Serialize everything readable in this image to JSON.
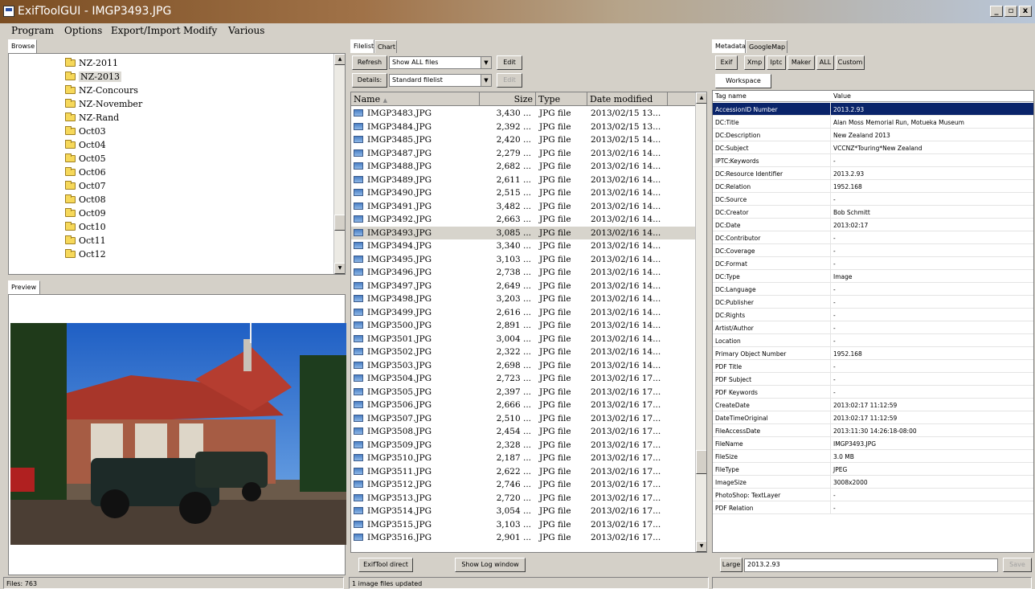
{
  "window": {
    "title": "ExifToolGUI - IMGP3493.JPG",
    "minimize": "_",
    "restore": "▫",
    "close": "x"
  },
  "menu": [
    "Program",
    "Options",
    "Export/Import",
    "Modify",
    "Various"
  ],
  "browse": {
    "tab": "Browse",
    "folders": [
      "NZ-2011",
      "NZ-2013",
      "NZ-Concours",
      "NZ-November",
      "NZ-Rand",
      "Oct03",
      "Oct04",
      "Oct05",
      "Oct06",
      "Oct07",
      "Oct08",
      "Oct09",
      "Oct10",
      "Oct11",
      "Oct12"
    ],
    "selected_index": 1
  },
  "preview": {
    "tab": "Preview"
  },
  "filelist": {
    "tabs": [
      "Filelist",
      "Chart"
    ],
    "refresh_label": "Refresh",
    "filter_value": "Show ALL files",
    "edit_label": "Edit",
    "details_label": "Details:",
    "details_value": "Standard filelist",
    "edit2_label": "Edit",
    "columns": [
      "Name",
      "Size",
      "Type",
      "Date modified"
    ],
    "rows": [
      [
        "IMGP3483.JPG",
        "3,430 ...",
        "JPG file",
        "2013/02/15 13..."
      ],
      [
        "IMGP3484.JPG",
        "2,392 ...",
        "JPG file",
        "2013/02/15 13..."
      ],
      [
        "IMGP3485.JPG",
        "2,420 ...",
        "JPG file",
        "2013/02/15 14..."
      ],
      [
        "IMGP3487.JPG",
        "2,279 ...",
        "JPG file",
        "2013/02/16 14..."
      ],
      [
        "IMGP3488.JPG",
        "2,682 ...",
        "JPG file",
        "2013/02/16 14..."
      ],
      [
        "IMGP3489.JPG",
        "2,611 ...",
        "JPG file",
        "2013/02/16 14..."
      ],
      [
        "IMGP3490.JPG",
        "2,515 ...",
        "JPG file",
        "2013/02/16 14..."
      ],
      [
        "IMGP3491.JPG",
        "3,482 ...",
        "JPG file",
        "2013/02/16 14..."
      ],
      [
        "IMGP3492.JPG",
        "2,663 ...",
        "JPG file",
        "2013/02/16 14..."
      ],
      [
        "IMGP3493.JPG",
        "3,085 ...",
        "JPG file",
        "2013/02/16 14..."
      ],
      [
        "IMGP3494.JPG",
        "3,340 ...",
        "JPG file",
        "2013/02/16 14..."
      ],
      [
        "IMGP3495.JPG",
        "3,103 ...",
        "JPG file",
        "2013/02/16 14..."
      ],
      [
        "IMGP3496.JPG",
        "2,738 ...",
        "JPG file",
        "2013/02/16 14..."
      ],
      [
        "IMGP3497.JPG",
        "2,649 ...",
        "JPG file",
        "2013/02/16 14..."
      ],
      [
        "IMGP3498.JPG",
        "3,203 ...",
        "JPG file",
        "2013/02/16 14..."
      ],
      [
        "IMGP3499.JPG",
        "2,616 ...",
        "JPG file",
        "2013/02/16 14..."
      ],
      [
        "IMGP3500.JPG",
        "2,891 ...",
        "JPG file",
        "2013/02/16 14..."
      ],
      [
        "IMGP3501.JPG",
        "3,004 ...",
        "JPG file",
        "2013/02/16 14..."
      ],
      [
        "IMGP3502.JPG",
        "2,322 ...",
        "JPG file",
        "2013/02/16 14..."
      ],
      [
        "IMGP3503.JPG",
        "2,698 ...",
        "JPG file",
        "2013/02/16 14..."
      ],
      [
        "IMGP3504.JPG",
        "2,723 ...",
        "JPG file",
        "2013/02/16 17..."
      ],
      [
        "IMGP3505.JPG",
        "2,397 ...",
        "JPG file",
        "2013/02/16 17..."
      ],
      [
        "IMGP3506.JPG",
        "2,666 ...",
        "JPG file",
        "2013/02/16 17..."
      ],
      [
        "IMGP3507.JPG",
        "2,510 ...",
        "JPG file",
        "2013/02/16 17..."
      ],
      [
        "IMGP3508.JPG",
        "2,454 ...",
        "JPG file",
        "2013/02/16 17..."
      ],
      [
        "IMGP3509.JPG",
        "2,328 ...",
        "JPG file",
        "2013/02/16 17..."
      ],
      [
        "IMGP3510.JPG",
        "2,187 ...",
        "JPG file",
        "2013/02/16 17..."
      ],
      [
        "IMGP3511.JPG",
        "2,622 ...",
        "JPG file",
        "2013/02/16 17..."
      ],
      [
        "IMGP3512.JPG",
        "2,746 ...",
        "JPG file",
        "2013/02/16 17..."
      ],
      [
        "IMGP3513.JPG",
        "2,720 ...",
        "JPG file",
        "2013/02/16 17..."
      ],
      [
        "IMGP3514.JPG",
        "3,054 ...",
        "JPG file",
        "2013/02/16 17..."
      ],
      [
        "IMGP3515.JPG",
        "3,103 ...",
        "JPG file",
        "2013/02/16 17..."
      ],
      [
        "IMGP3516.JPG",
        "2,901 ...",
        "JPG file",
        "2013/02/16 17..."
      ]
    ],
    "selected_index": 9,
    "exiftool_direct_label": "ExifTool direct",
    "show_log_label": "Show Log window"
  },
  "metadata": {
    "tabs": [
      "Metadata",
      "GoogleMap"
    ],
    "buttons": [
      "Exif",
      "Xmp",
      "Iptc",
      "Maker",
      "ALL",
      "Custom"
    ],
    "workspace_tab": "Workspace",
    "columns": [
      "Tag name",
      "Value"
    ],
    "rows": [
      [
        "AccessionID Number",
        "2013.2.93"
      ],
      [
        "DC:Title",
        "Alan Moss Memorial Run, Motueka Museum"
      ],
      [
        "DC:Description",
        "New Zealand 2013"
      ],
      [
        "DC:Subject",
        "VCCNZ*Touring*New Zealand"
      ],
      [
        "IPTC:Keywords",
        "-"
      ],
      [
        "DC:Resource Identifier",
        "2013.2.93"
      ],
      [
        "DC:Relation",
        "1952.168"
      ],
      [
        "DC:Source",
        "-"
      ],
      [
        "DC:Creator",
        "Bob Schmitt"
      ],
      [
        "DC:Date",
        "2013:02:17"
      ],
      [
        "DC:Contributor",
        "-"
      ],
      [
        "DC:Coverage",
        "-"
      ],
      [
        "DC:Format",
        "-"
      ],
      [
        "DC:Type",
        "Image"
      ],
      [
        "DC:Language",
        "-"
      ],
      [
        "DC:Publisher",
        "-"
      ],
      [
        "DC:Rights",
        "-"
      ],
      [
        "Artist/Author",
        "-"
      ],
      [
        "Location",
        "-"
      ],
      [
        "Primary Object Number",
        "1952.168"
      ],
      [
        "PDF Title",
        "-"
      ],
      [
        "PDF Subject",
        "-"
      ],
      [
        "PDF Keywords",
        "-"
      ],
      [
        "CreateDate",
        "2013:02:17 11:12:59"
      ],
      [
        "DateTimeOriginal",
        "2013:02:17 11:12:59"
      ],
      [
        "FileAccessDate",
        "2013:11:30 14:26:18-08:00"
      ],
      [
        "FileName",
        "IMGP3493.JPG"
      ],
      [
        "FileSize",
        "3.0 MB"
      ],
      [
        "FileType",
        "JPEG"
      ],
      [
        "ImageSize",
        "3008x2000"
      ],
      [
        "PhotoShop: TextLayer",
        "-"
      ],
      [
        "PDF Relation",
        "-"
      ]
    ],
    "selected_index": 0,
    "large_label": "Large",
    "edit_value": "2013.2.93",
    "save_label": "Save"
  },
  "status": {
    "files": "Files: 763",
    "message": "1 image files updated"
  }
}
